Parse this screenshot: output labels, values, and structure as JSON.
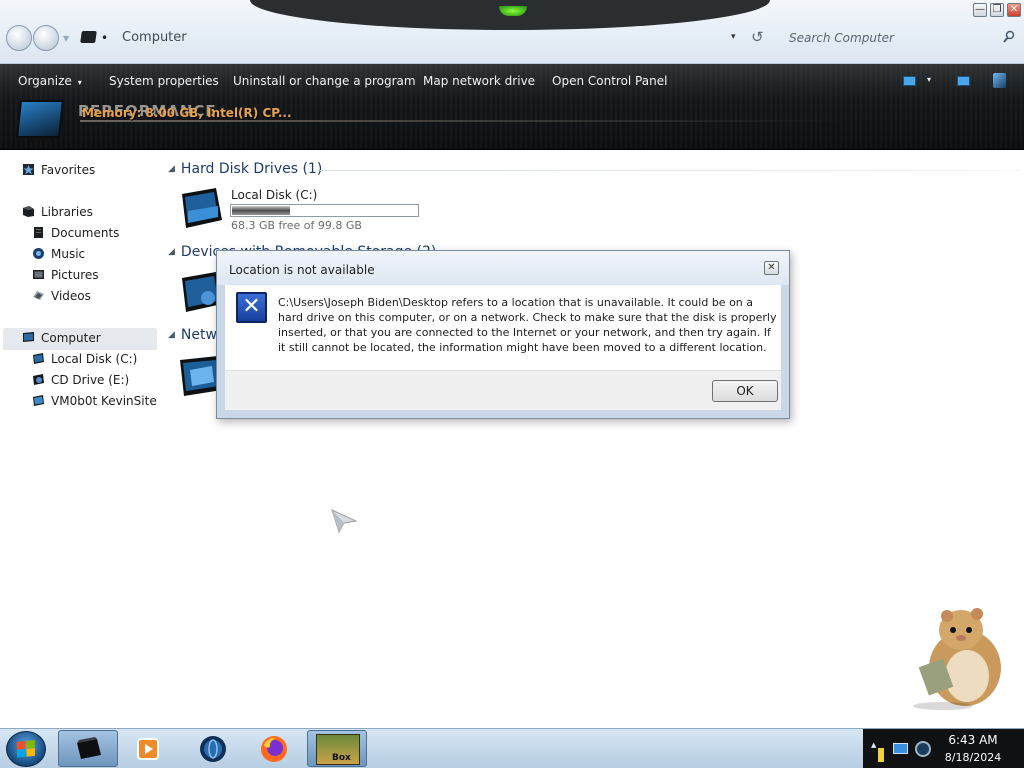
{
  "window": {
    "controls": {
      "minimize": "—",
      "restore": "❐",
      "close": "✕"
    }
  },
  "address_bar": {
    "path": "Computer",
    "dropdown_glyph": "▾",
    "refresh_glyph": "↺",
    "search_placeholder": "Search Computer"
  },
  "toolbar": {
    "organize": "Organize",
    "organize_caret": "▾",
    "system_properties": "System properties",
    "uninstall": "Uninstall or change a program",
    "map_drive": "Map network drive",
    "control_panel": "Open Control Panel",
    "view_caret": "▾"
  },
  "header_overlay": {
    "performance": "PERFORMANCE",
    "cpu": "Memory: 8.00 GB, Intel(R) CP..."
  },
  "nav": {
    "favorites": "Favorites",
    "libraries": "Libraries",
    "documents": "Documents",
    "music": "Music",
    "pictures": "Pictures",
    "videos": "Videos",
    "computer": "Computer",
    "local_disk": "Local Disk (C:)",
    "cd_drive": "CD Drive (E:)",
    "network_share": "VM0b0t KevinSite"
  },
  "content": {
    "hard_disk_header": "Hard Disk Drives (1)",
    "removable_header": "Devices with Removable Storage (2)",
    "network_header": "Network Location (1)",
    "local_disk": {
      "label": "Local Disk (C:)",
      "free_text": "68.3 GB free of 99.8 GB",
      "used_fraction": 0.316
    }
  },
  "dialog": {
    "title": "Location is not available",
    "close_glyph": "✕",
    "icon_glyph": "✕",
    "message": "C:\\Users\\Joseph Biden\\Desktop refers to a location that is unavailable. It could be on a hard drive on this computer, or on a network. Check to make sure that the disk is properly inserted, or that you are connected to the Internet or your network, and then try again. If it still cannot be located, the information might have been moved to a different location.",
    "ok_label": "OK"
  },
  "taskbar": {
    "time": "6:43 AM",
    "date": "8/18/2024",
    "box_label": "Box"
  },
  "colors": {
    "accent_blue": "#1e3c6e",
    "command_bar": "#15181a",
    "dialog_frame": "#c9d7e6",
    "taskbar": "#c7dbee"
  }
}
